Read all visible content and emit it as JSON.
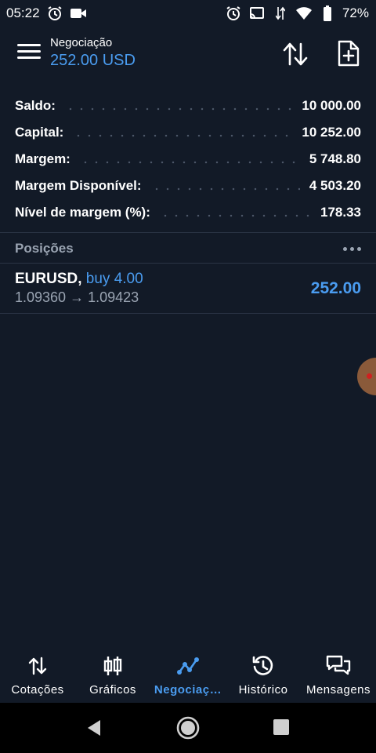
{
  "status": {
    "time": "05:22",
    "battery": "72%"
  },
  "header": {
    "title": "Negociação",
    "subtitle": "252.00 USD"
  },
  "summary": [
    {
      "label": "Saldo:",
      "value": "10 000.00"
    },
    {
      "label": "Capital:",
      "value": "10 252.00"
    },
    {
      "label": "Margem:",
      "value": "5 748.80"
    },
    {
      "label": "Margem Disponível:",
      "value": "4 503.20"
    },
    {
      "label": "Nível de margem (%):",
      "value": "178.33"
    }
  ],
  "positions": {
    "title": "Posições",
    "items": [
      {
        "symbol": "EURUSD,",
        "side": "buy 4.00",
        "prices": "1.09360 → 1.09423",
        "profit": "252.00"
      }
    ]
  },
  "tabs": [
    {
      "label": "Cotações",
      "icon": "arrows-updown-icon"
    },
    {
      "label": "Gráficos",
      "icon": "candlestick-icon"
    },
    {
      "label": "Negociaç…",
      "icon": "trade-line-icon"
    },
    {
      "label": "Histórico",
      "icon": "history-icon"
    },
    {
      "label": "Mensagens",
      "icon": "chat-icon"
    }
  ],
  "colors": {
    "background": "#121a27",
    "accent": "#4a9cf0",
    "muted": "#9aa4b2"
  }
}
